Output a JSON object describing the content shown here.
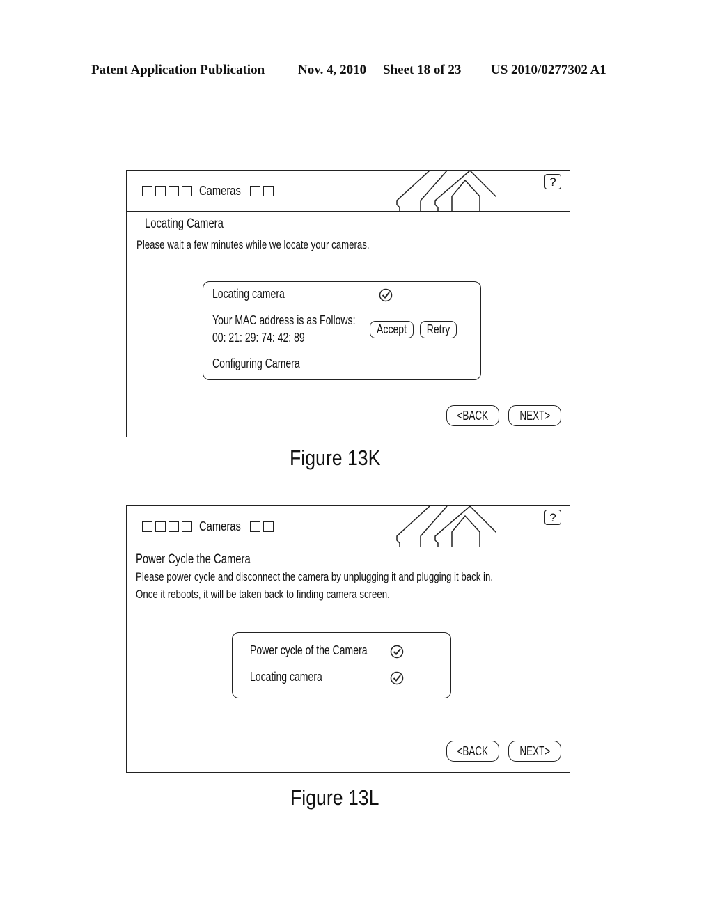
{
  "header": {
    "publication": "Patent Application Publication",
    "date": "Nov. 4, 2010",
    "sheet": "Sheet 18 of 23",
    "number": "US 2010/0277302 A1"
  },
  "figures": [
    {
      "caption": "Figure 13K",
      "app_title": "Cameras",
      "help_label": "?",
      "heading": "Locating Camera",
      "instructions": [
        "Please wait a few minutes while we locate your cameras."
      ],
      "panel": {
        "step1": {
          "label": "Locating camera",
          "status": "check-circle-icon"
        },
        "mac_prompt": "Your MAC address is as Follows:",
        "mac_value": "00: 21: 29: 74: 42: 89",
        "accept_label": "Accept",
        "retry_label": "Retry",
        "step2": {
          "label": "Configuring Camera"
        }
      },
      "back_label": "<BACK",
      "next_label": "NEXT>"
    },
    {
      "caption": "Figure 13L",
      "app_title": "Cameras",
      "help_label": "?",
      "heading": "Power Cycle the Camera",
      "instructions": [
        "Please power cycle and disconnect the camera by unplugging it and plugging it back in.",
        "Once it reboots, it will be taken back to finding camera screen."
      ],
      "panel": {
        "steps": [
          {
            "label": "Power cycle of the Camera",
            "status": "check-circle-icon"
          },
          {
            "label": "Locating camera",
            "status": "check-circle-icon"
          }
        ]
      },
      "back_label": "<BACK",
      "next_label": "NEXT>"
    }
  ]
}
